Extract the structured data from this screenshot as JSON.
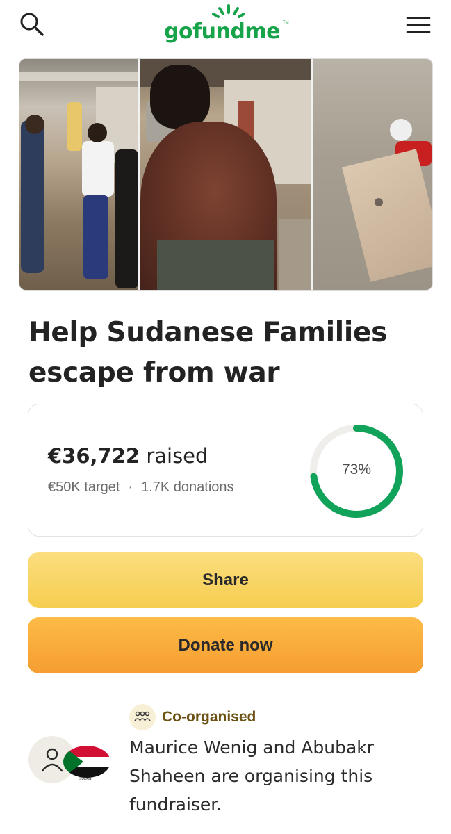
{
  "header": {
    "logo": "gofundme",
    "logo_tm": "TM",
    "icons": {
      "search": "search-icon",
      "menu": "hamburger-menu-icon"
    }
  },
  "hero": {
    "photos": [
      "photo-people-gathered",
      "photo-injured-back",
      "photo-victim-on-ground"
    ]
  },
  "campaign": {
    "title": "Help Sudanese Families escape from war"
  },
  "progress": {
    "raised_amount": "€36,722",
    "raised_suffix": "raised",
    "target": "€50K target",
    "separator": "·",
    "donations": "1.7K donations",
    "percent_label": "73%",
    "percent_value": 0.73,
    "ring_color": "#12a35a",
    "track_color": "#f0eeeb"
  },
  "actions": {
    "share_label": "Share",
    "donate_label": "Donate now"
  },
  "organisers": {
    "badge_label": "Co-organised",
    "flag_caption": "SUDAN",
    "description": "Maurice Wenig and Abubakr Shaheen are organising this fundraiser."
  },
  "colors": {
    "brand_green": "#16a34a",
    "share_button": "#f6cd4f",
    "donate_button": "#f59d31"
  }
}
